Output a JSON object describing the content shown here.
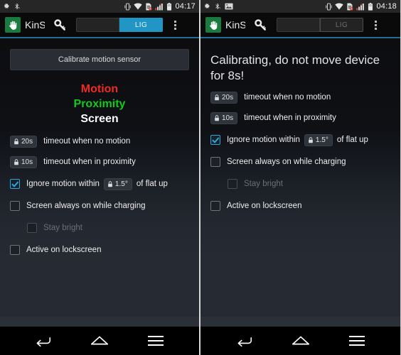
{
  "screens": [
    {
      "id": "before-calibration",
      "statusbar": {
        "left_icons": [
          "settings-gear-icon",
          "bluetooth-off-icon"
        ],
        "right_icons": [
          "vibrate-icon",
          "wifi-icon",
          "sd-card-error-icon",
          "signal-bars-icon",
          "battery-icon"
        ],
        "clock": "04:17"
      },
      "actionbar": {
        "app_icon": "hand-app-icon",
        "title": "KinS",
        "key_icon": "key-icon",
        "toggle_left_label": "",
        "toggle_right_label": "LIG",
        "toggle_right_active": true,
        "overflow_icon": "overflow-menu-icon"
      },
      "main": {
        "calibrate_button": "Calibrate motion sensor",
        "show_calibrate_button": true,
        "banner": "",
        "show_banner": false,
        "sensor_readouts": [
          {
            "label": "Motion",
            "color": "#ee2a22"
          },
          {
            "label": "Proximity",
            "color": "#14c81e"
          },
          {
            "label": "Screen",
            "color": "#ffffff"
          }
        ],
        "show_readouts": true
      },
      "settings": [
        {
          "type": "badge",
          "badge_value": "20s",
          "badge_icon": "lock-icon",
          "label": "timeout when no motion"
        },
        {
          "type": "badge",
          "badge_value": "10s",
          "badge_icon": "lock-icon",
          "label": "timeout when in proximity"
        },
        {
          "type": "checkbox-inline-badge",
          "checked": true,
          "enabled": true,
          "label_before": "Ignore motion within",
          "badge_value": "1.5°",
          "badge_icon": "lock-icon",
          "label_after": "of flat up"
        },
        {
          "type": "checkbox",
          "checked": false,
          "enabled": true,
          "label": "Screen always on while charging"
        },
        {
          "type": "checkbox",
          "checked": false,
          "enabled": false,
          "indented": true,
          "label": "Stay bright"
        },
        {
          "type": "checkbox",
          "checked": false,
          "enabled": true,
          "label": "Active on lockscreen"
        }
      ],
      "navbar": {
        "back": "back-icon",
        "home": "home-icon",
        "recents": "recent-apps-icon"
      }
    },
    {
      "id": "during-calibration",
      "statusbar": {
        "left_icons": [
          "settings-gear-icon",
          "bluetooth-off-icon",
          "screenshot-image-icon"
        ],
        "right_icons": [
          "vibrate-icon",
          "wifi-icon",
          "sd-card-error-icon",
          "signal-bars-icon",
          "battery-icon"
        ],
        "clock": "04:18"
      },
      "actionbar": {
        "app_icon": "hand-app-icon",
        "title": "KinS",
        "key_icon": "key-icon",
        "toggle_left_label": "",
        "toggle_right_label": "LIG",
        "toggle_right_active": false,
        "overflow_icon": "overflow-menu-icon"
      },
      "main": {
        "calibrate_button": "",
        "show_calibrate_button": false,
        "banner": "Calibrating, do not move device for 8s!",
        "show_banner": true,
        "sensor_readouts": [],
        "show_readouts": false
      },
      "settings": [
        {
          "type": "badge",
          "badge_value": "20s",
          "badge_icon": "lock-icon",
          "label": "timeout when no motion"
        },
        {
          "type": "badge",
          "badge_value": "10s",
          "badge_icon": "lock-icon",
          "label": "timeout when in proximity"
        },
        {
          "type": "checkbox-inline-badge",
          "checked": true,
          "enabled": true,
          "label_before": "Ignore motion within",
          "badge_value": "1.5°",
          "badge_icon": "lock-icon",
          "label_after": "of flat up"
        },
        {
          "type": "checkbox",
          "checked": false,
          "enabled": true,
          "label": "Screen always on while charging"
        },
        {
          "type": "checkbox",
          "checked": false,
          "enabled": false,
          "indented": true,
          "label": "Stay bright"
        },
        {
          "type": "checkbox",
          "checked": false,
          "enabled": true,
          "label": "Active on lockscreen"
        }
      ],
      "navbar": {
        "back": "back-icon",
        "home": "home-icon",
        "recents": "recent-apps-icon"
      }
    }
  ],
  "colors": {
    "accent_blue": "#2196c4",
    "check_blue": "#29a8dd",
    "motion_red": "#ee2a22",
    "proximity_green": "#14c81e",
    "app_green": "#1b7a3e",
    "content_bg": "#262a33",
    "nav_bg": "#000000"
  }
}
